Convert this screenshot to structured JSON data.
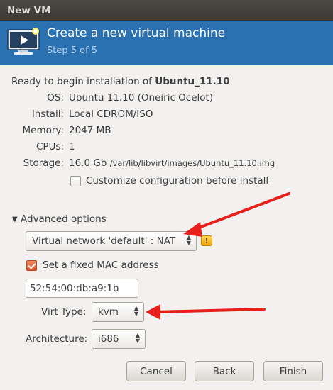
{
  "window": {
    "title": "New VM"
  },
  "banner": {
    "title": "Create a new virtual machine",
    "step": "Step 5 of 5"
  },
  "summary": {
    "intro_prefix": "Ready to begin installation of ",
    "vm_name": "Ubuntu_11.10",
    "rows": [
      {
        "label": "OS:",
        "value": "Ubuntu 11.10 (Oneiric Ocelot)"
      },
      {
        "label": "Install:",
        "value": "Local CDROM/ISO"
      },
      {
        "label": "Memory:",
        "value": "2047 MB"
      },
      {
        "label": "CPUs:",
        "value": "1"
      },
      {
        "label": "Storage:",
        "value_main": "16.0 Gb",
        "value_path": "/var/lib/libvirt/images/Ubuntu_11.10.img"
      }
    ],
    "customize_label": "Customize configuration before install",
    "customize_checked": false
  },
  "advanced": {
    "expander_label": "Advanced options",
    "network_selected": "Virtual network 'default' : NAT",
    "mac_label": "Set a fixed MAC address",
    "mac_checked": true,
    "mac_value": "52:54:00:db:a9:1b",
    "virt_type_label": "Virt Type:",
    "virt_type_value": "kvm",
    "arch_label": "Architecture:",
    "arch_value": "i686"
  },
  "buttons": {
    "cancel": "Cancel",
    "back": "Back",
    "finish": "Finish"
  },
  "icons": {
    "expander": "triangle-down-icon",
    "combo": "up-down-arrows-icon",
    "warning": "warning-icon",
    "vm": "monitor-play-icon"
  },
  "colors": {
    "banner": "#2b70b0",
    "annotation_arrow": "#e8201c",
    "titlebar": "#3c3b37"
  }
}
